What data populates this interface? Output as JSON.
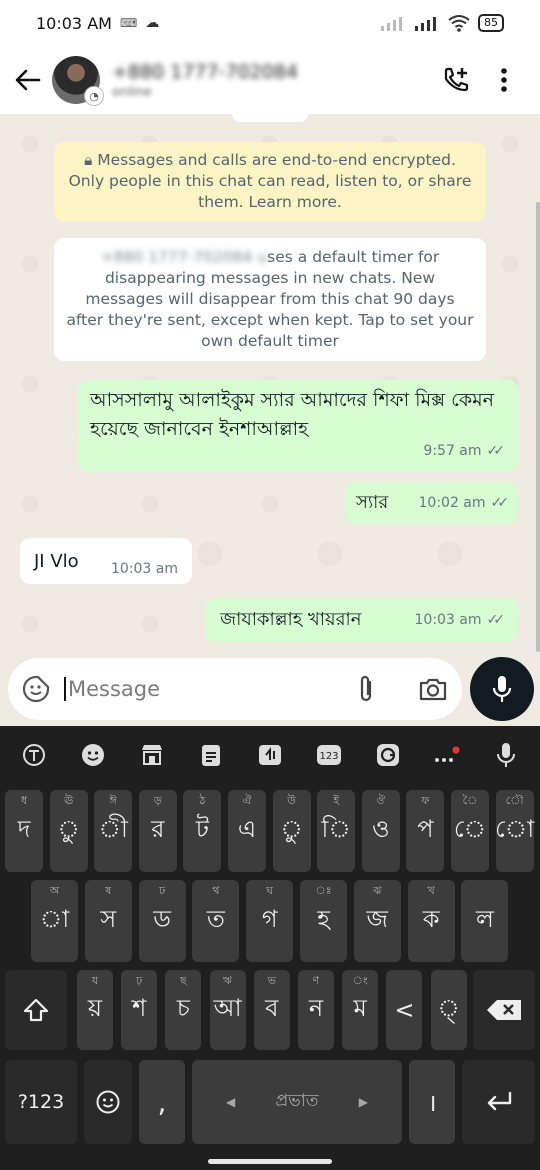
{
  "status_bar": {
    "time": "10:03 AM",
    "battery": "85"
  },
  "header": {
    "contact_name": "+880 1777-702084",
    "contact_status": "online",
    "icons": [
      "back-arrow-icon",
      "add-call-icon",
      "more-vert-icon"
    ]
  },
  "chat": {
    "encryption_notice": "Messages and calls are end-to-end encrypted. Only people in this chat can read, listen to, or share them. Learn more.",
    "timer_notice_blurred": "+880 1777-702084 u",
    "timer_notice_text": "ses a default timer for disappearing messages in new chats. New messages will disappear from this chat 90 days after they're sent, except when kept. Tap to set your own default timer",
    "messages": [
      {
        "direction": "out",
        "text": "আসসালামু আলাইকুম স্যার আমাদের শিফা মিক্স কেমন হয়েছে জানাবেন ইনশাআল্লাহ",
        "time": "9:57 am"
      },
      {
        "direction": "out",
        "text": "স্যার",
        "time": "10:02 am"
      },
      {
        "direction": "in",
        "text": "JI Vlo",
        "time": "10:03 am"
      },
      {
        "direction": "out",
        "text": "জাযাকাল্লাহ খায়রান",
        "time": "10:03 am"
      }
    ]
  },
  "composer": {
    "placeholder": "Message"
  },
  "keyboard": {
    "row1": [
      {
        "main": "দ",
        "hint": "ধ"
      },
      {
        "main": "ু",
        "hint": "ঊ"
      },
      {
        "main": "ী",
        "hint": "ঈ"
      },
      {
        "main": "র",
        "hint": "ড়"
      },
      {
        "main": "ট",
        "hint": "ঠ"
      },
      {
        "main": "এ",
        "hint": "ঐ"
      },
      {
        "main": "ু",
        "hint": "উ"
      },
      {
        "main": "ি",
        "hint": "ই"
      },
      {
        "main": "ও",
        "hint": "ঔ"
      },
      {
        "main": "প",
        "hint": "ফ"
      },
      {
        "main": "ে",
        "hint": "ৈ"
      },
      {
        "main": "ো",
        "hint": "ৌ"
      }
    ],
    "row2": [
      {
        "main": "া",
        "hint": "অ"
      },
      {
        "main": "স",
        "hint": "ষ"
      },
      {
        "main": "ড",
        "hint": "ঢ"
      },
      {
        "main": "ত",
        "hint": "থ"
      },
      {
        "main": "গ",
        "hint": "ঘ"
      },
      {
        "main": "হ",
        "hint": "ঃ"
      },
      {
        "main": "জ",
        "hint": "ঝ"
      },
      {
        "main": "ক",
        "hint": "খ"
      },
      {
        "main": "ল",
        "hint": ""
      }
    ],
    "row3": [
      {
        "main": "য়",
        "hint": "য"
      },
      {
        "main": "শ",
        "hint": "ঢ়"
      },
      {
        "main": "চ",
        "hint": "ছ"
      },
      {
        "main": "আ",
        "hint": "ঋ"
      },
      {
        "main": "ব",
        "hint": "ভ"
      },
      {
        "main": "ন",
        "hint": "ণ"
      },
      {
        "main": "ম",
        "hint": "ং"
      },
      {
        "main": "<",
        "hint": ""
      },
      {
        "main": "্",
        "hint": ""
      }
    ],
    "symbols_label": "?123",
    "comma": ",",
    "space_label": "প্রভাত",
    "danda": "।"
  }
}
